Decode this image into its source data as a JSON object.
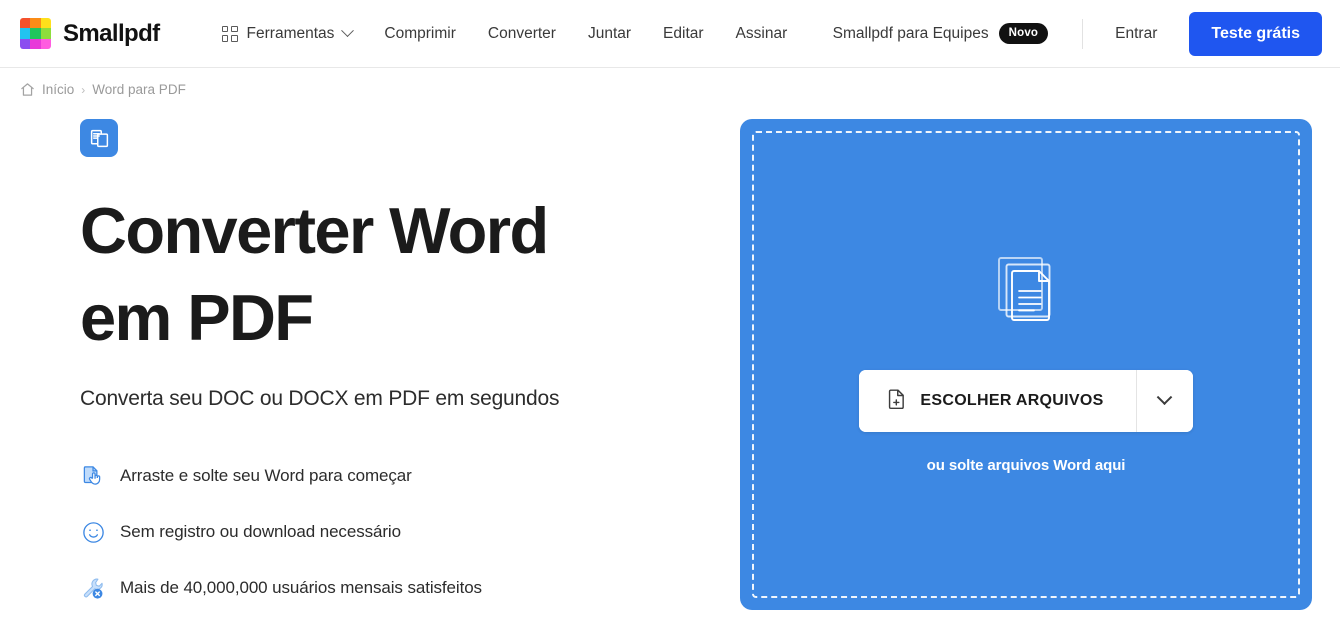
{
  "header": {
    "brand": {
      "name": "Smallpdf",
      "logo_icon": "smallpdf-logo-grid",
      "logo_colors": [
        "#f4512c",
        "#fb8c17",
        "#ffe01b",
        "#21c3f0",
        "#21c55d",
        "#8ede3c",
        "#8b4ef0",
        "#e83ad9",
        "#ff5ce0"
      ]
    },
    "tools": {
      "label": "Ferramentas",
      "icon": "grid-icon",
      "chevron": "chevron-down-icon"
    },
    "nav": [
      {
        "label": "Comprimir"
      },
      {
        "label": "Converter"
      },
      {
        "label": "Juntar"
      },
      {
        "label": "Editar"
      },
      {
        "label": "Assinar"
      }
    ],
    "teams": {
      "label": "Smallpdf para Equipes",
      "badge": "Novo"
    },
    "signin": "Entrar",
    "cta": "Teste grátis",
    "accent_color": "#1f56f0"
  },
  "breadcrumb": {
    "home_icon": "home-icon",
    "home": "Início",
    "separator": "›",
    "current": "Word para PDF"
  },
  "main": {
    "tool_icon": "convert-document-icon",
    "headline": "Converter Word em PDF",
    "subtitle": "Converta seu DOC ou DOCX em PDF em segundos",
    "features": [
      {
        "icon": "drag-drop-icon",
        "text": "Arraste e solte seu Word para começar"
      },
      {
        "icon": "smiley-face-icon",
        "text": "Sem registro ou download necessário"
      },
      {
        "icon": "wrench-icon",
        "text": "Mais de 40,000,000 usuários mensais satisfeitos"
      }
    ]
  },
  "dropzone": {
    "icon": "stacked-documents-icon",
    "choose_label": "ESCOLHER ARQUIVOS",
    "choose_icon": "add-file-icon",
    "chevron": "chevron-down-icon",
    "hint": "ou solte arquivos Word aqui",
    "background_color": "#3d88e3"
  }
}
